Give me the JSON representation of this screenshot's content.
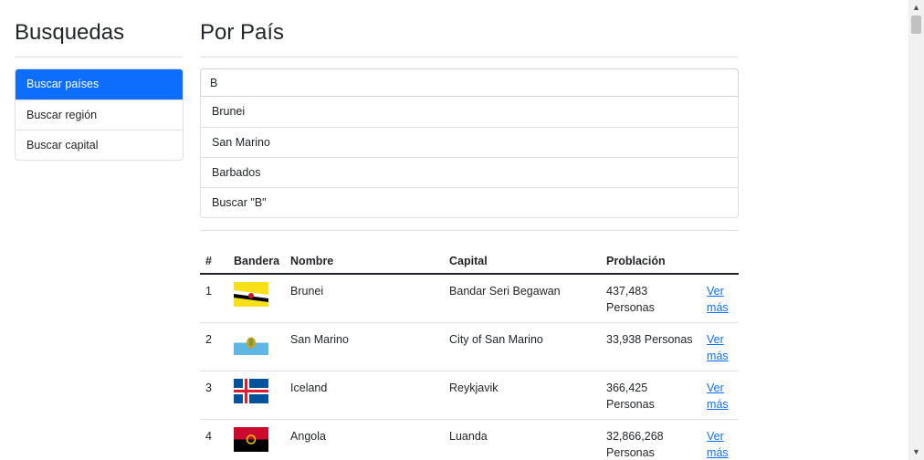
{
  "sidebar": {
    "title": "Busquedas",
    "items": [
      {
        "label": "Buscar países",
        "active": true
      },
      {
        "label": "Buscar región",
        "active": false
      },
      {
        "label": "Buscar capital",
        "active": false
      }
    ]
  },
  "main": {
    "title": "Por País",
    "search": {
      "value": "B",
      "placeholder": ""
    },
    "suggestions": [
      "Brunei",
      "San Marino",
      "Barbados",
      "Buscar \"B\""
    ]
  },
  "table": {
    "headers": [
      "#",
      "Bandera",
      "Nombre",
      "Capital",
      "Problación",
      ""
    ],
    "rows": [
      {
        "num": "1",
        "flag": "brunei-flag-icon",
        "name": "Brunei",
        "capital": "Bandar Seri Begawan",
        "population": "437,483 Personas",
        "link": "Ver más"
      },
      {
        "num": "2",
        "flag": "san-marino-flag-icon",
        "name": "San Marino",
        "capital": "City of San Marino",
        "population": "33,938 Personas",
        "link": "Ver más"
      },
      {
        "num": "3",
        "flag": "iceland-flag-icon",
        "name": "Iceland",
        "capital": "Reykjavik",
        "population": "366,425 Personas",
        "link": "Ver más"
      },
      {
        "num": "4",
        "flag": "angola-flag-icon",
        "name": "Angola",
        "capital": "Luanda",
        "population": "32,866,268 Personas",
        "link": "Ver más"
      }
    ]
  },
  "colors": {
    "accent": "#0d6efd",
    "link": "#0d6efd",
    "text": "#212529",
    "border": "#dee2e6"
  }
}
